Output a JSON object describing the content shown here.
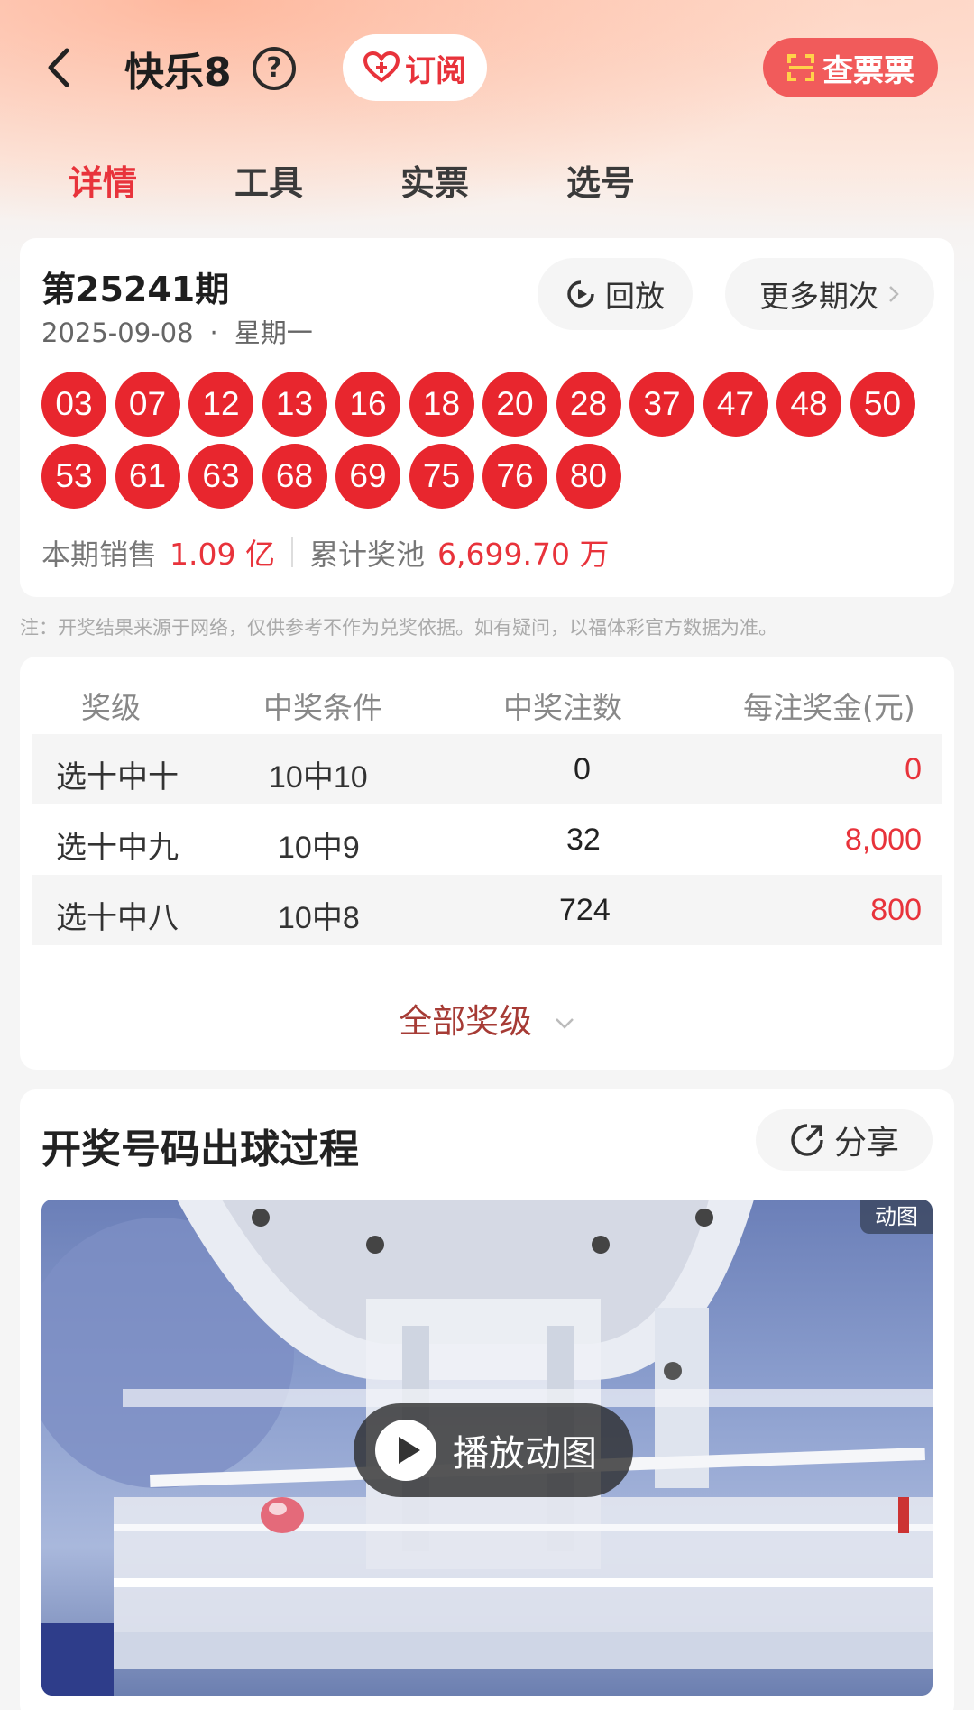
{
  "header": {
    "title": "快乐8",
    "help_symbol": "?",
    "subscribe_label": "订阅",
    "check_ticket_label": "查票票"
  },
  "tabs": [
    {
      "label": "详情",
      "active": true
    },
    {
      "label": "工具",
      "active": false
    },
    {
      "label": "实票",
      "active": false
    },
    {
      "label": "选号",
      "active": false
    }
  ],
  "draw": {
    "issue": "第25241期",
    "date": "2025-09-08",
    "separator": "·",
    "weekday": "星期一",
    "replay_label": "回放",
    "more_label": "更多期次",
    "numbers": [
      "03",
      "07",
      "12",
      "13",
      "16",
      "18",
      "20",
      "28",
      "37",
      "47",
      "48",
      "50",
      "53",
      "61",
      "63",
      "68",
      "69",
      "75",
      "76",
      "80"
    ],
    "sales_label": "本期销售",
    "sales_value": "1.09 亿",
    "pool_label": "累计奖池",
    "pool_value": "6,699.70 万"
  },
  "note": "注：开奖结果来源于网络，仅供参考不作为兑奖依据。如有疑问，以福体彩官方数据为准。",
  "prize_table": {
    "headers": [
      "奖级",
      "中奖条件",
      "中奖注数",
      "每注奖金(元)"
    ],
    "rows": [
      {
        "level": "选十中十",
        "condition": "10中10",
        "count": "0",
        "amount": "0"
      },
      {
        "level": "选十中九",
        "condition": "10中9",
        "count": "32",
        "amount": "8,000"
      },
      {
        "level": "选十中八",
        "condition": "10中8",
        "count": "724",
        "amount": "800"
      }
    ],
    "all_levels_label": "全部奖级"
  },
  "process": {
    "title": "开奖号码出球过程",
    "share_label": "分享",
    "gif_badge": "动图",
    "play_label": "播放动图"
  },
  "colors": {
    "accent_red": "#e8333b",
    "ball_red": "#e8262e",
    "check_btn": "#f15b5b"
  }
}
